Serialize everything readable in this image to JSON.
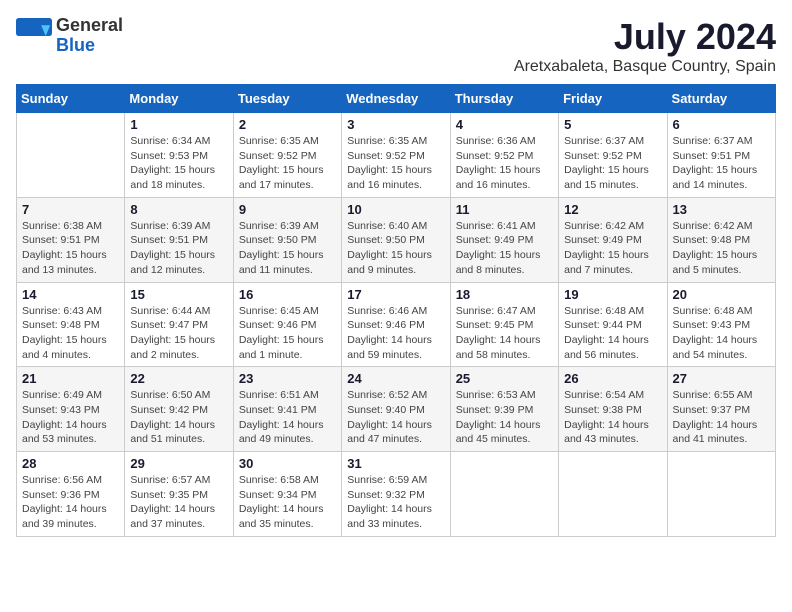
{
  "header": {
    "logo": {
      "general": "General",
      "blue": "Blue"
    },
    "title": "July 2024",
    "subtitle": "Aretxabaleta, Basque Country, Spain"
  },
  "calendar": {
    "weekdays": [
      "Sunday",
      "Monday",
      "Tuesday",
      "Wednesday",
      "Thursday",
      "Friday",
      "Saturday"
    ],
    "weeks": [
      [
        {
          "day": "",
          "info": ""
        },
        {
          "day": "1",
          "info": "Sunrise: 6:34 AM\nSunset: 9:53 PM\nDaylight: 15 hours and 18 minutes."
        },
        {
          "day": "2",
          "info": "Sunrise: 6:35 AM\nSunset: 9:52 PM\nDaylight: 15 hours and 17 minutes."
        },
        {
          "day": "3",
          "info": "Sunrise: 6:35 AM\nSunset: 9:52 PM\nDaylight: 15 hours and 16 minutes."
        },
        {
          "day": "4",
          "info": "Sunrise: 6:36 AM\nSunset: 9:52 PM\nDaylight: 15 hours and 16 minutes."
        },
        {
          "day": "5",
          "info": "Sunrise: 6:37 AM\nSunset: 9:52 PM\nDaylight: 15 hours and 15 minutes."
        },
        {
          "day": "6",
          "info": "Sunrise: 6:37 AM\nSunset: 9:51 PM\nDaylight: 15 hours and 14 minutes."
        }
      ],
      [
        {
          "day": "7",
          "info": "Sunrise: 6:38 AM\nSunset: 9:51 PM\nDaylight: 15 hours and 13 minutes."
        },
        {
          "day": "8",
          "info": "Sunrise: 6:39 AM\nSunset: 9:51 PM\nDaylight: 15 hours and 12 minutes."
        },
        {
          "day": "9",
          "info": "Sunrise: 6:39 AM\nSunset: 9:50 PM\nDaylight: 15 hours and 11 minutes."
        },
        {
          "day": "10",
          "info": "Sunrise: 6:40 AM\nSunset: 9:50 PM\nDaylight: 15 hours and 9 minutes."
        },
        {
          "day": "11",
          "info": "Sunrise: 6:41 AM\nSunset: 9:49 PM\nDaylight: 15 hours and 8 minutes."
        },
        {
          "day": "12",
          "info": "Sunrise: 6:42 AM\nSunset: 9:49 PM\nDaylight: 15 hours and 7 minutes."
        },
        {
          "day": "13",
          "info": "Sunrise: 6:42 AM\nSunset: 9:48 PM\nDaylight: 15 hours and 5 minutes."
        }
      ],
      [
        {
          "day": "14",
          "info": "Sunrise: 6:43 AM\nSunset: 9:48 PM\nDaylight: 15 hours and 4 minutes."
        },
        {
          "day": "15",
          "info": "Sunrise: 6:44 AM\nSunset: 9:47 PM\nDaylight: 15 hours and 2 minutes."
        },
        {
          "day": "16",
          "info": "Sunrise: 6:45 AM\nSunset: 9:46 PM\nDaylight: 15 hours and 1 minute."
        },
        {
          "day": "17",
          "info": "Sunrise: 6:46 AM\nSunset: 9:46 PM\nDaylight: 14 hours and 59 minutes."
        },
        {
          "day": "18",
          "info": "Sunrise: 6:47 AM\nSunset: 9:45 PM\nDaylight: 14 hours and 58 minutes."
        },
        {
          "day": "19",
          "info": "Sunrise: 6:48 AM\nSunset: 9:44 PM\nDaylight: 14 hours and 56 minutes."
        },
        {
          "day": "20",
          "info": "Sunrise: 6:48 AM\nSunset: 9:43 PM\nDaylight: 14 hours and 54 minutes."
        }
      ],
      [
        {
          "day": "21",
          "info": "Sunrise: 6:49 AM\nSunset: 9:43 PM\nDaylight: 14 hours and 53 minutes."
        },
        {
          "day": "22",
          "info": "Sunrise: 6:50 AM\nSunset: 9:42 PM\nDaylight: 14 hours and 51 minutes."
        },
        {
          "day": "23",
          "info": "Sunrise: 6:51 AM\nSunset: 9:41 PM\nDaylight: 14 hours and 49 minutes."
        },
        {
          "day": "24",
          "info": "Sunrise: 6:52 AM\nSunset: 9:40 PM\nDaylight: 14 hours and 47 minutes."
        },
        {
          "day": "25",
          "info": "Sunrise: 6:53 AM\nSunset: 9:39 PM\nDaylight: 14 hours and 45 minutes."
        },
        {
          "day": "26",
          "info": "Sunrise: 6:54 AM\nSunset: 9:38 PM\nDaylight: 14 hours and 43 minutes."
        },
        {
          "day": "27",
          "info": "Sunrise: 6:55 AM\nSunset: 9:37 PM\nDaylight: 14 hours and 41 minutes."
        }
      ],
      [
        {
          "day": "28",
          "info": "Sunrise: 6:56 AM\nSunset: 9:36 PM\nDaylight: 14 hours and 39 minutes."
        },
        {
          "day": "29",
          "info": "Sunrise: 6:57 AM\nSunset: 9:35 PM\nDaylight: 14 hours and 37 minutes."
        },
        {
          "day": "30",
          "info": "Sunrise: 6:58 AM\nSunset: 9:34 PM\nDaylight: 14 hours and 35 minutes."
        },
        {
          "day": "31",
          "info": "Sunrise: 6:59 AM\nSunset: 9:32 PM\nDaylight: 14 hours and 33 minutes."
        },
        {
          "day": "",
          "info": ""
        },
        {
          "day": "",
          "info": ""
        },
        {
          "day": "",
          "info": ""
        }
      ]
    ]
  }
}
